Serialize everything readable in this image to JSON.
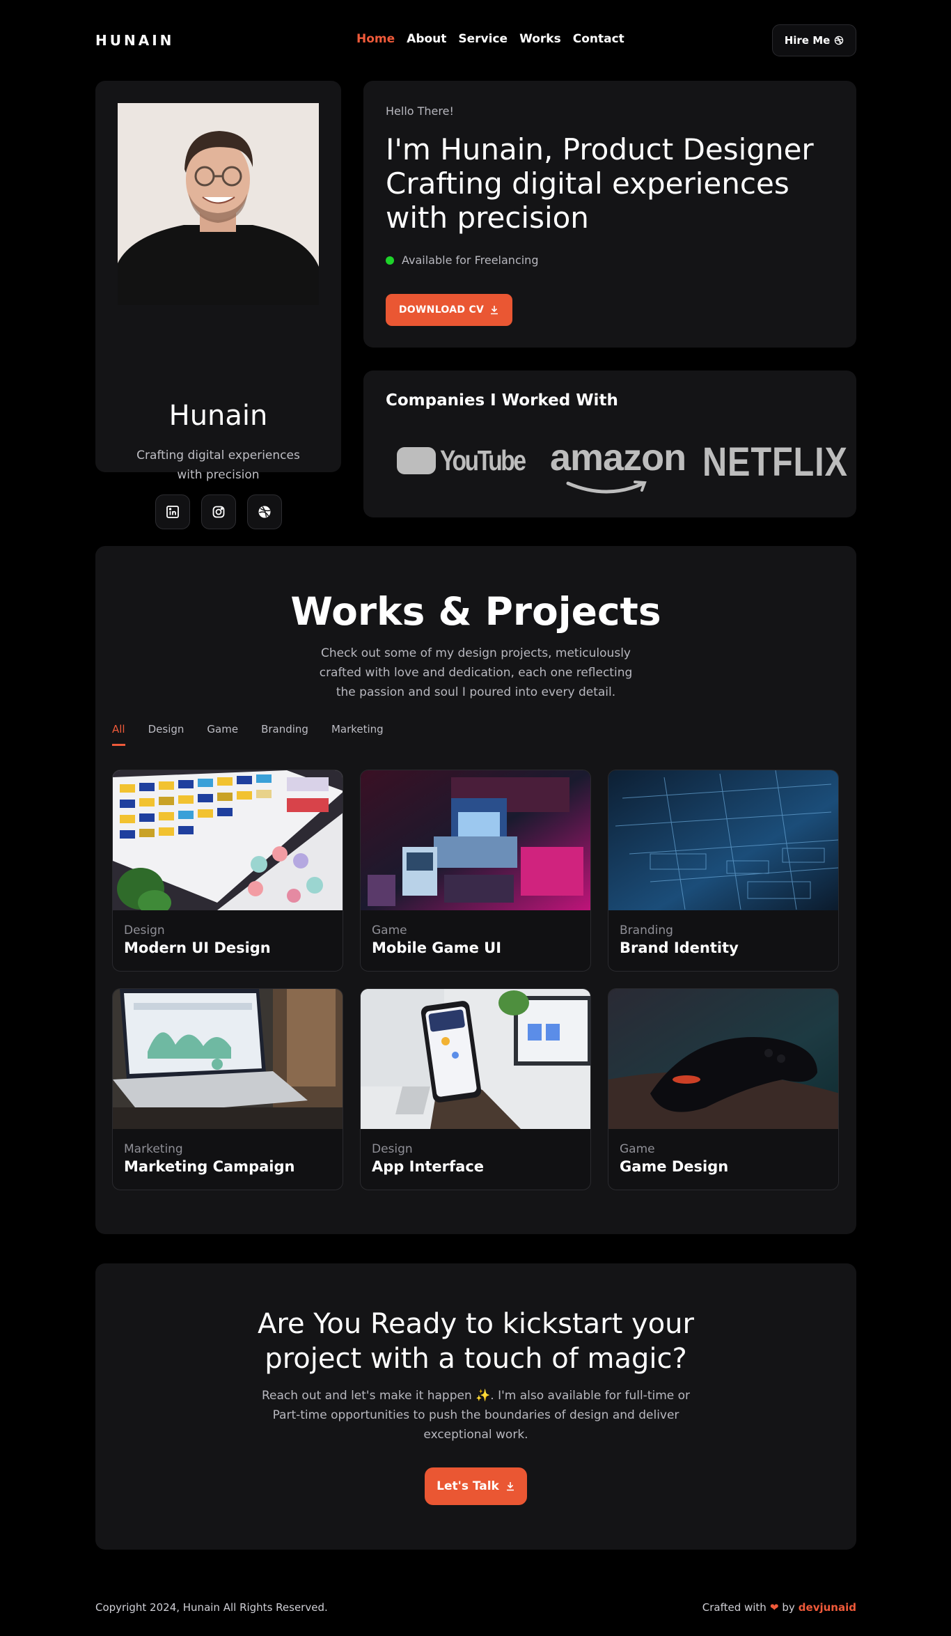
{
  "brand": {
    "logo": "HUNAIN",
    "accent": "#EA5733"
  },
  "nav": {
    "items": [
      {
        "label": "Home",
        "active": true
      },
      {
        "label": "About",
        "active": false
      },
      {
        "label": "Service",
        "active": false
      },
      {
        "label": "Works",
        "active": false
      },
      {
        "label": "Contact",
        "active": false
      }
    ],
    "hire_label": "Hire Me"
  },
  "profile": {
    "name": "Hunain",
    "tagline": "Crafting digital experiences with precision",
    "socials": [
      "linkedin-icon",
      "instagram-icon",
      "dribbble-icon"
    ]
  },
  "hero": {
    "greeting": "Hello There!",
    "headline": "I'm Hunain, Product Designer Crafting digital experiences with precision",
    "availability": "Available for Freelancing",
    "availability_color": "#1ED32A",
    "cv_label": "DOWNLOAD CV"
  },
  "companies": {
    "title": "Companies I Worked With",
    "logos": [
      "YouTube",
      "amazon",
      "NETFLIX"
    ]
  },
  "works": {
    "title": "Works & Projects",
    "description": "Check out some of my design projects, meticulously crafted with love and dedication, each one reflecting the passion and soul I poured into every detail.",
    "tabs": [
      {
        "label": "All",
        "active": true
      },
      {
        "label": "Design",
        "active": false
      },
      {
        "label": "Game",
        "active": false
      },
      {
        "label": "Branding",
        "active": false
      },
      {
        "label": "Marketing",
        "active": false
      }
    ],
    "projects": [
      {
        "category": "Design",
        "title": "Modern UI Design"
      },
      {
        "category": "Game",
        "title": "Mobile Game UI"
      },
      {
        "category": "Branding",
        "title": "Brand Identity"
      },
      {
        "category": "Marketing",
        "title": "Marketing Campaign"
      },
      {
        "category": "Design",
        "title": "App Interface"
      },
      {
        "category": "Game",
        "title": "Game Design"
      }
    ]
  },
  "cta": {
    "title_line1": "Are You Ready to kickstart your",
    "title_line2": "project with a touch of magic?",
    "description": "Reach out and let's make it happen ✨. I'm also available for full-time or Part-time opportunities to push the boundaries of design and deliver exceptional work.",
    "button_label": "Let's Talk"
  },
  "footer": {
    "copyright": "Copyright 2024, Hunain All Rights Reserved.",
    "crafted_prefix": "Crafted with",
    "crafted_by": "by",
    "author": "devjunaid"
  }
}
